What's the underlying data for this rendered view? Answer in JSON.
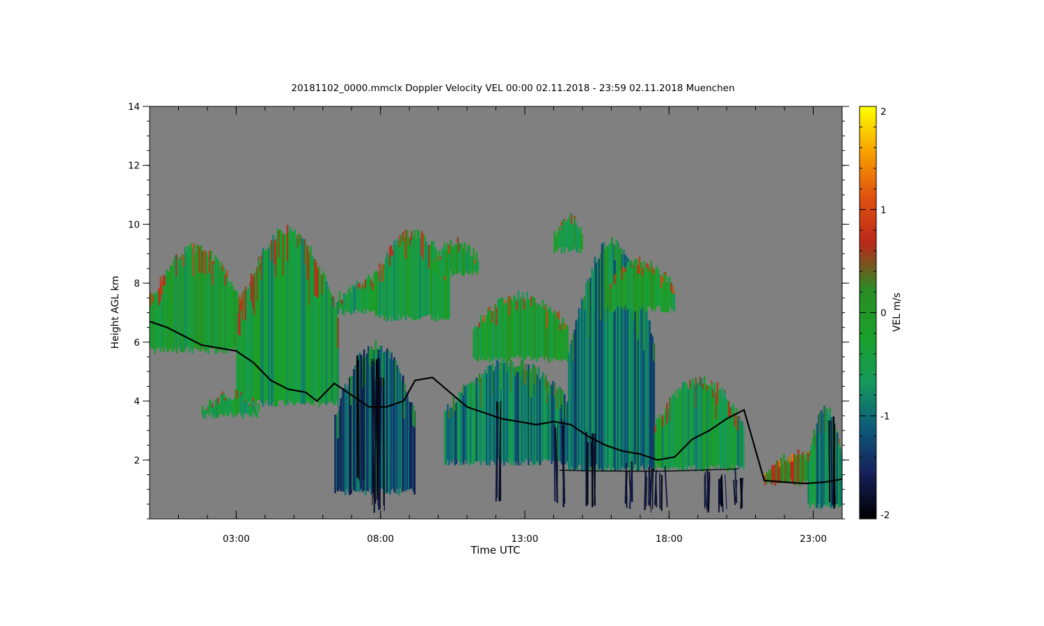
{
  "chart_data": {
    "type": "heatmap",
    "title": "20181102_0000.mmclx Doppler Velocity VEL   00:00 02.11.2018 - 23:59 02.11.2018 Muenchen",
    "xlabel": "Time UTC",
    "ylabel": "Height AGL km",
    "x_range_hours": [
      0.0,
      24.0
    ],
    "x_ticks": [
      {
        "value": 3,
        "label": "03:00"
      },
      {
        "value": 8,
        "label": "08:00"
      },
      {
        "value": 13,
        "label": "13:00"
      },
      {
        "value": 18,
        "label": "18:00"
      },
      {
        "value": 23,
        "label": "23:00"
      }
    ],
    "ylim": [
      0,
      14
    ],
    "y_ticks": [
      2,
      4,
      6,
      8,
      10,
      12,
      14
    ],
    "colorbar": {
      "label": "VEL m/s",
      "range": [
        -2,
        2
      ],
      "ticks": [
        -2,
        -1,
        0,
        1,
        2
      ],
      "colors": [
        "#000000",
        "#16205a",
        "#0d5b7a",
        "#169a5a",
        "#1aa02a",
        "#2a8c24",
        "#b8281a",
        "#e05010",
        "#f8a000",
        "#ffff00"
      ]
    },
    "background_color": "#808080",
    "echo_regions": [
      {
        "t_start": 0.0,
        "t_end": 3.1,
        "base_km": 5.6,
        "top_km": 9.4,
        "mean_vel": -0.3
      },
      {
        "t_start": 3.0,
        "t_end": 6.5,
        "base_km": 3.8,
        "top_km": 10.0,
        "mean_vel": -0.5
      },
      {
        "t_start": 1.8,
        "t_end": 3.8,
        "base_km": 3.4,
        "top_km": 4.4,
        "mean_vel": -0.4
      },
      {
        "t_start": 6.4,
        "t_end": 9.2,
        "base_km": 0.8,
        "top_km": 6.1,
        "mean_vel": -1.2
      },
      {
        "t_start": 6.5,
        "t_end": 9.5,
        "base_km": 6.9,
        "top_km": 8.4,
        "mean_vel": -0.5
      },
      {
        "t_start": 7.8,
        "t_end": 10.4,
        "base_km": 6.7,
        "top_km": 9.9,
        "mean_vel": -0.4
      },
      {
        "t_start": 9.8,
        "t_end": 11.4,
        "base_km": 8.2,
        "top_km": 9.6,
        "mean_vel": -0.3
      },
      {
        "t_start": 10.2,
        "t_end": 14.8,
        "base_km": 1.8,
        "top_km": 5.5,
        "mean_vel": -0.9
      },
      {
        "t_start": 11.2,
        "t_end": 14.5,
        "base_km": 5.3,
        "top_km": 7.8,
        "mean_vel": -0.2
      },
      {
        "t_start": 14.0,
        "t_end": 15.0,
        "base_km": 9.0,
        "top_km": 10.4,
        "mean_vel": -0.3
      },
      {
        "t_start": 14.5,
        "t_end": 17.5,
        "base_km": 1.6,
        "top_km": 9.6,
        "mean_vel": -1.0
      },
      {
        "t_start": 15.8,
        "t_end": 18.2,
        "base_km": 7.0,
        "top_km": 8.9,
        "mean_vel": -0.2
      },
      {
        "t_start": 17.5,
        "t_end": 20.6,
        "base_km": 1.6,
        "top_km": 4.9,
        "mean_vel": -0.5
      },
      {
        "t_start": 21.3,
        "t_end": 24.0,
        "base_km": 1.1,
        "top_km": 2.4,
        "mean_vel": 0.3
      },
      {
        "t_start": 22.8,
        "t_end": 24.0,
        "base_km": 0.3,
        "top_km": 3.9,
        "mean_vel": -0.8
      }
    ],
    "fall_streaks": [
      {
        "t": 7.8,
        "top_km": 5.5,
        "bottom_km": 0.4
      },
      {
        "t": 8.0,
        "top_km": 5.0,
        "bottom_km": 0.2
      },
      {
        "t": 7.3,
        "top_km": 5.8,
        "bottom_km": 1.2
      },
      {
        "t": 12.2,
        "top_km": 4.0,
        "bottom_km": 0.5
      },
      {
        "t": 14.2,
        "top_km": 3.5,
        "bottom_km": 0.3
      },
      {
        "t": 15.3,
        "top_km": 3.0,
        "bottom_km": 0.3
      },
      {
        "t": 16.6,
        "top_km": 2.0,
        "bottom_km": 0.3
      },
      {
        "t": 17.3,
        "top_km": 1.8,
        "bottom_km": 0.2
      },
      {
        "t": 17.7,
        "top_km": 1.8,
        "bottom_km": 0.2
      },
      {
        "t": 19.4,
        "top_km": 1.7,
        "bottom_km": 0.2
      },
      {
        "t": 19.9,
        "top_km": 1.7,
        "bottom_km": 0.2
      },
      {
        "t": 20.4,
        "top_km": 1.7,
        "bottom_km": 0.3
      },
      {
        "t": 23.7,
        "top_km": 3.5,
        "bottom_km": 0.3
      }
    ],
    "melting_layer_line": [
      {
        "t": 0.0,
        "h": 6.7
      },
      {
        "t": 0.6,
        "h": 6.5
      },
      {
        "t": 1.2,
        "h": 6.2
      },
      {
        "t": 1.8,
        "h": 5.9
      },
      {
        "t": 2.4,
        "h": 5.8
      },
      {
        "t": 3.0,
        "h": 5.7
      },
      {
        "t": 3.6,
        "h": 5.3
      },
      {
        "t": 4.2,
        "h": 4.7
      },
      {
        "t": 4.8,
        "h": 4.4
      },
      {
        "t": 5.4,
        "h": 4.3
      },
      {
        "t": 5.8,
        "h": 4.0
      },
      {
        "t": 6.4,
        "h": 4.6
      },
      {
        "t": 7.0,
        "h": 4.2
      },
      {
        "t": 7.6,
        "h": 3.8
      },
      {
        "t": 8.2,
        "h": 3.8
      },
      {
        "t": 8.8,
        "h": 4.0
      },
      {
        "t": 9.2,
        "h": 4.7
      },
      {
        "t": 9.8,
        "h": 4.8
      },
      {
        "t": 10.4,
        "h": 4.3
      },
      {
        "t": 11.0,
        "h": 3.8
      },
      {
        "t": 11.6,
        "h": 3.6
      },
      {
        "t": 12.2,
        "h": 3.4
      },
      {
        "t": 12.8,
        "h": 3.3
      },
      {
        "t": 13.4,
        "h": 3.2
      },
      {
        "t": 14.0,
        "h": 3.3
      },
      {
        "t": 14.6,
        "h": 3.2
      },
      {
        "t": 15.2,
        "h": 2.8
      },
      {
        "t": 15.8,
        "h": 2.5
      },
      {
        "t": 16.4,
        "h": 2.3
      },
      {
        "t": 17.0,
        "h": 2.2
      },
      {
        "t": 17.6,
        "h": 2.0
      },
      {
        "t": 18.2,
        "h": 2.1
      },
      {
        "t": 18.8,
        "h": 2.7
      },
      {
        "t": 19.4,
        "h": 3.0
      },
      {
        "t": 20.0,
        "h": 3.4
      },
      {
        "t": 20.6,
        "h": 3.7
      },
      {
        "t": 21.3,
        "h": 1.3
      },
      {
        "t": 22.0,
        "h": 1.25
      },
      {
        "t": 22.7,
        "h": 1.2
      },
      {
        "t": 23.4,
        "h": 1.25
      },
      {
        "t": 24.0,
        "h": 1.35
      }
    ],
    "cloud_base_line": [
      {
        "t": 14.2,
        "h": 1.65
      },
      {
        "t": 15.4,
        "h": 1.63
      },
      {
        "t": 16.6,
        "h": 1.62
      },
      {
        "t": 17.8,
        "h": 1.62
      },
      {
        "t": 19.0,
        "h": 1.65
      },
      {
        "t": 20.4,
        "h": 1.7
      }
    ]
  }
}
